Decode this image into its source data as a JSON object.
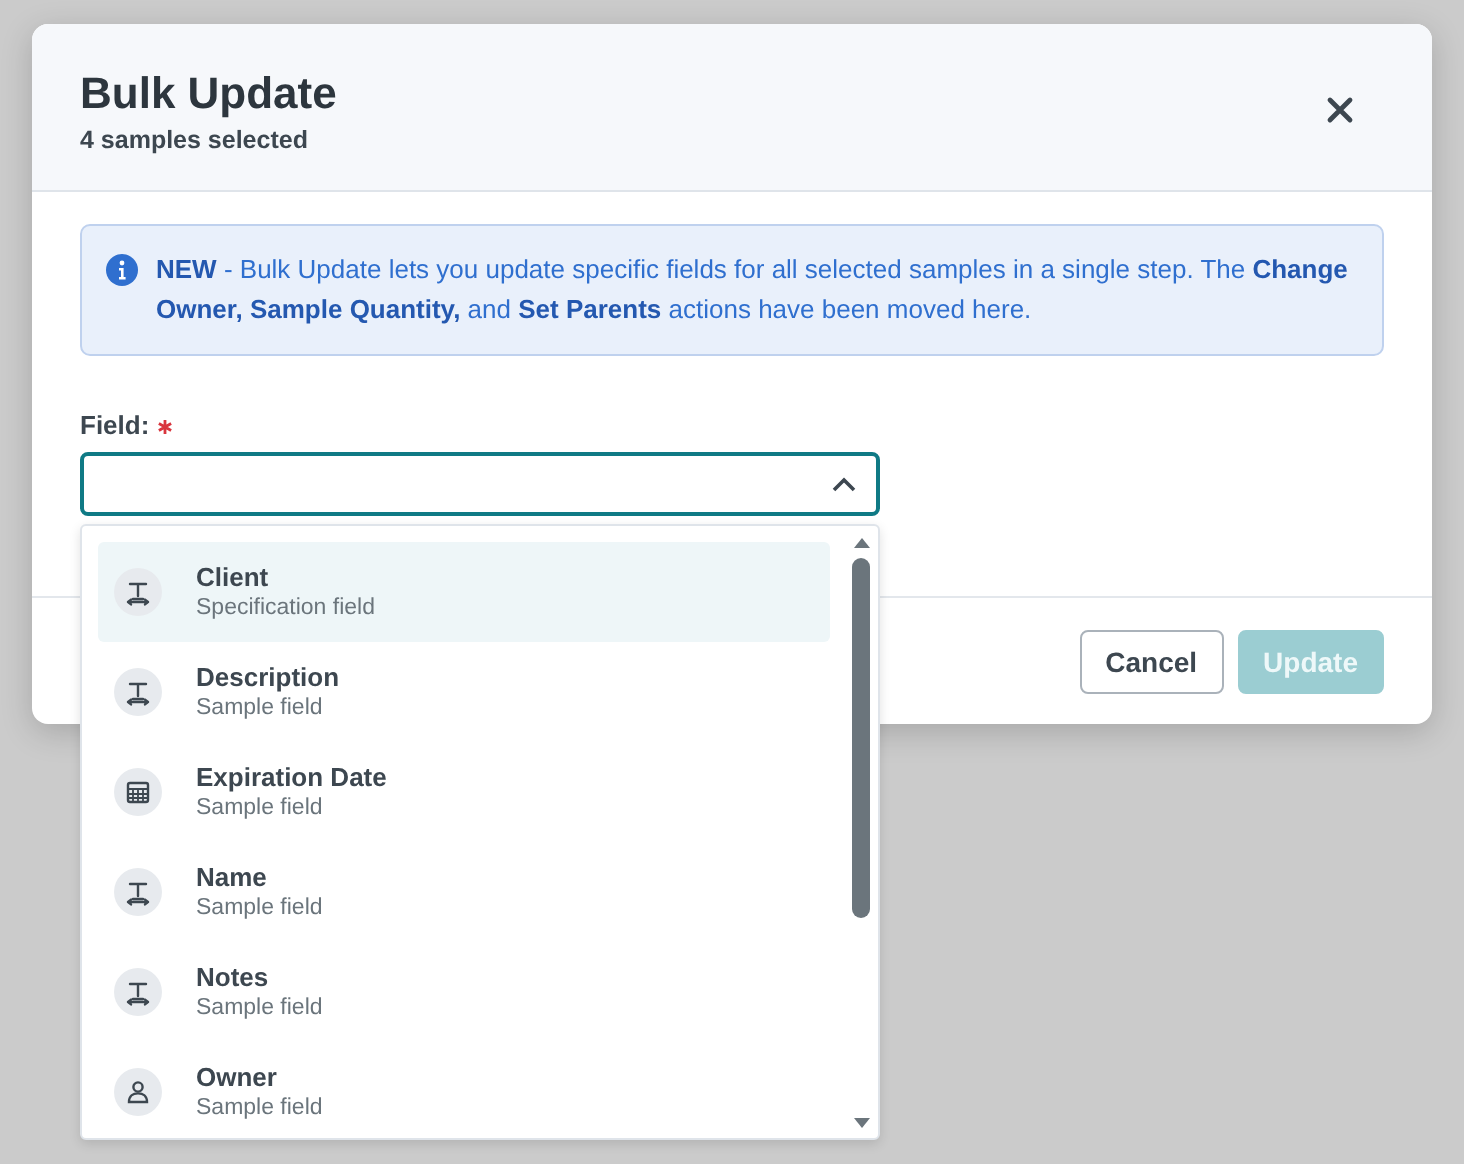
{
  "dialog": {
    "title": "Bulk Update",
    "subtitle": "4 samples selected",
    "notice": "**NEW** - Bulk Update lets you update specific fields for all selected samples in a single step. The **Change Owner, Sample Quantity,** and **Set Parents** actions have been moved here.",
    "field": {
      "label": "Field:",
      "required": true,
      "expanded": true
    },
    "options": [
      {
        "kind": "text",
        "label": "Client",
        "detail": "Specification field",
        "selected": true
      },
      {
        "kind": "text",
        "label": "Description",
        "detail": "Sample field",
        "selected": false
      },
      {
        "kind": "calendar",
        "label": "Expiration Date",
        "detail": "Sample field",
        "selected": false
      },
      {
        "kind": "text",
        "label": "Name",
        "detail": "Sample field",
        "selected": false
      },
      {
        "kind": "text",
        "label": "Notes",
        "detail": "Sample field",
        "selected": false
      },
      {
        "kind": "person",
        "label": "Owner",
        "detail": "Sample field",
        "selected": false
      }
    ],
    "buttons": [
      {
        "kind": "secondary",
        "label": "Cancel",
        "disabled": false
      },
      {
        "kind": "primary",
        "label": "Update",
        "disabled": true
      }
    ]
  }
}
